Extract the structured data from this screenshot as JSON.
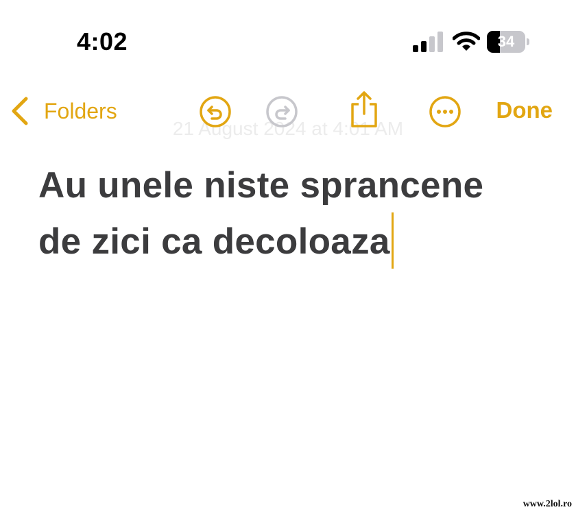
{
  "status_bar": {
    "time": "4:02",
    "battery_level": "34",
    "signal_icon": "cellular-signal-icon",
    "wifi_icon": "wifi-icon",
    "battery_icon": "battery-icon"
  },
  "toolbar": {
    "back_label": "Folders",
    "back_icon": "chevron-left-icon",
    "undo_icon": "undo-icon",
    "redo_icon": "redo-icon",
    "share_icon": "share-icon",
    "more_icon": "more-icon",
    "done_label": "Done"
  },
  "note": {
    "date": "21 August 2024 at 4:01 AM",
    "lines": [
      "Au unele niste sprancene",
      "de zici ca decoloaza"
    ]
  },
  "watermark": "www.2lol.ro",
  "colors": {
    "accent": "#e2a612",
    "text": "#3c3c3e",
    "disabled": "#c7c7cc"
  }
}
